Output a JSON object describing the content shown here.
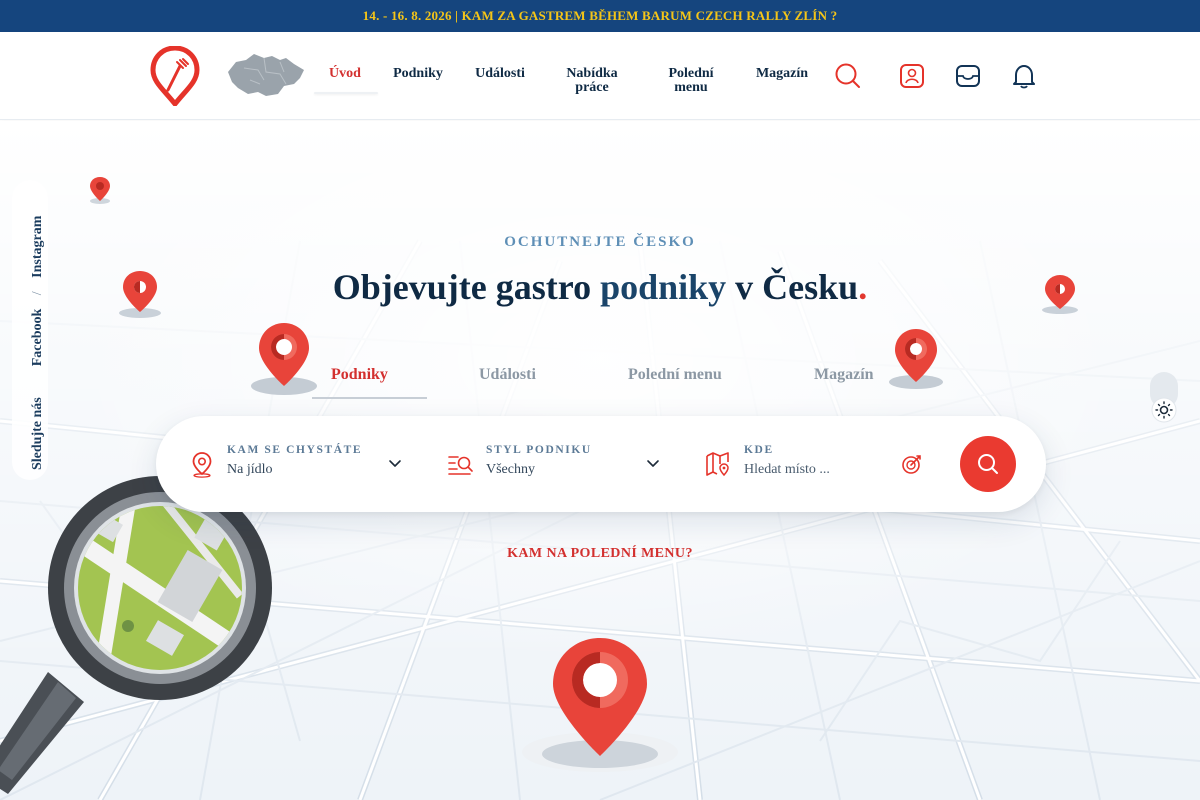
{
  "announcement": {
    "text": "14. - 16. 8. 2026 | KAM ZA GASTREM BĚHEM BARUM CZECH RALLY ZLÍN ?"
  },
  "nav": {
    "items": [
      {
        "label": "Úvod",
        "active": true
      },
      {
        "label": "Podniky"
      },
      {
        "label": "Události"
      },
      {
        "label": "Nabídka práce"
      },
      {
        "label": "Polední menu"
      },
      {
        "label": "Magazín"
      }
    ],
    "icons": [
      "search-icon",
      "user-profile-icon",
      "inbox-icon",
      "notification-bell-icon"
    ]
  },
  "social": {
    "follow": "Sledujte nás",
    "facebook": "Facebook",
    "separator": "/",
    "instagram": "Instagram"
  },
  "hero": {
    "eyebrow": "OCHUTNEJTE ČESKO",
    "headline_start": "Objevujte gastro",
    "headline_highlight": "podniky",
    "headline_end": "v Česku",
    "headline_dot": "."
  },
  "tabs": [
    {
      "label": "Podniky",
      "active": true
    },
    {
      "label": "Události"
    },
    {
      "label": "Polední menu"
    },
    {
      "label": "Magazín"
    }
  ],
  "search": {
    "destination": {
      "label": "KAM SE CHYSTÁTE",
      "value": "Na jídlo"
    },
    "style": {
      "label": "STYL PODNIKU",
      "value": "Všechny"
    },
    "where": {
      "label": "KDE",
      "placeholder": "Hledat místo ..."
    }
  },
  "cta": {
    "text": "KAM NA POLEDNÍ MENU?"
  },
  "colors": {
    "brand_red": "#ea3a30",
    "navy": "#0f2a44",
    "topbar": "#15457e",
    "topbar_text": "#f5c518"
  }
}
